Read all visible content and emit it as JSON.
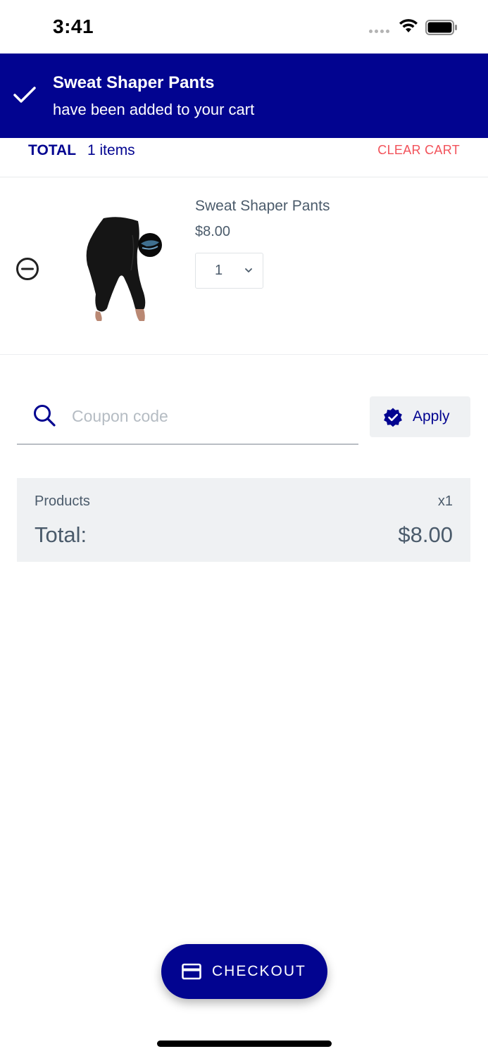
{
  "status_bar": {
    "time": "3:41",
    "icons": [
      "signal-dots-icon",
      "wifi-icon",
      "battery-icon"
    ]
  },
  "toast": {
    "title": "Sweat Shaper Pants",
    "message": "have been added to your cart",
    "icon": "check-icon",
    "background": "#020490"
  },
  "cart_header": {
    "total_label": "TOTAL",
    "items_count": "1 items",
    "clear_cart_label": "CLEAR CART",
    "clear_cart_color": "#f2525a"
  },
  "cart_items": [
    {
      "name": "Sweat Shaper Pants",
      "price": "$8.00",
      "quantity": "1",
      "image": "black-shaper-pants-photo"
    }
  ],
  "coupon": {
    "placeholder": "Coupon code",
    "value": "",
    "apply_label": "Apply",
    "apply_icon": "verified-badge-icon"
  },
  "summary": {
    "products_label": "Products",
    "products_count": "x1",
    "total_label": "Total:",
    "total_value": "$8.00"
  },
  "checkout": {
    "label": "CHECKOUT",
    "icon": "credit-card-icon"
  },
  "colors": {
    "primary": "#020490",
    "text": "#4b5b6b",
    "panel": "#eff1f3",
    "danger": "#f2525a"
  }
}
